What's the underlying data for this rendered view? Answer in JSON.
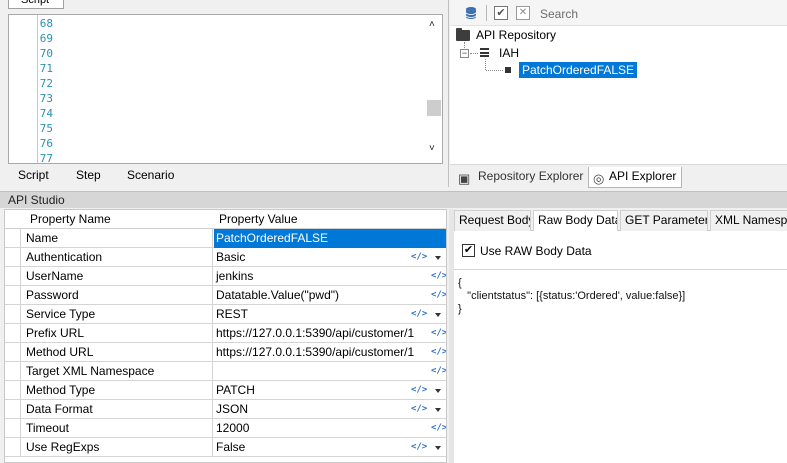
{
  "script_panel": {
    "tab_label": "Script",
    "line_numbers": [
      "68",
      "69",
      "70",
      "71",
      "72",
      "73",
      "74",
      "75",
      "76",
      "77"
    ],
    "bottom_tabs": [
      "Script",
      "Step",
      "Scenario"
    ]
  },
  "repo_panel": {
    "search_placeholder": "Search",
    "tree": {
      "root": "API Repository",
      "child": "IAH",
      "selected_leaf": "PatchOrderedFALSE"
    },
    "tabs": [
      "Repository Explorer",
      "API Explorer"
    ]
  },
  "api_studio": {
    "title": "API Studio",
    "columns": [
      "Property Name",
      "Property Value"
    ],
    "rows": [
      {
        "name": "Name",
        "value": "PatchOrderedFALSE",
        "selected": true
      },
      {
        "name": "Authentication",
        "value": "Basic",
        "dropdown": true
      },
      {
        "name": "UserName",
        "value": "jenkins"
      },
      {
        "name": "Password",
        "value": "Datatable.Value(\"pwd\")"
      },
      {
        "name": "Service Type",
        "value": "REST",
        "dropdown": true
      },
      {
        "name": "Prefix URL",
        "value": "https://127.0.0.1:5390/api/customer/1"
      },
      {
        "name": "Method URL",
        "value": "https://127.0.0.1:5390/api/customer/1"
      },
      {
        "name": "Target XML Namespace",
        "value": ""
      },
      {
        "name": "Method Type",
        "value": "PATCH",
        "dropdown": true
      },
      {
        "name": "Data Format",
        "value": "JSON",
        "dropdown": true
      },
      {
        "name": "Timeout",
        "value": "12000"
      },
      {
        "name": "Use RegExps",
        "value": "False",
        "dropdown": true
      }
    ]
  },
  "body_panel": {
    "tabs": [
      "Request Body",
      "Raw Body Data",
      "GET Parameters",
      "XML Namespac"
    ],
    "active_tab": "Raw Body Data",
    "use_raw_label": "Use RAW Body Data",
    "use_raw_checked": true,
    "raw_text": "{\n   \"clientstatus\": [{status:'Ordered', value:false}]\n}"
  },
  "colors": {
    "selection": "#0078d7",
    "line_numbers": "#2b91af",
    "code_icon": "#2d6fc4"
  }
}
